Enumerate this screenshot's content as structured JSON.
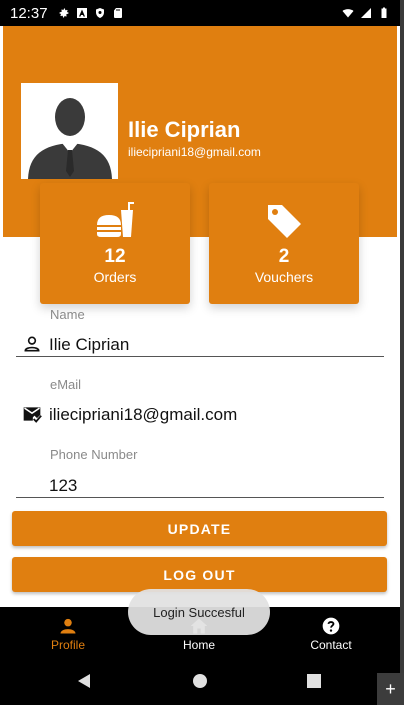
{
  "status_bar": {
    "time": "12:37"
  },
  "profile": {
    "name": "Ilie Ciprian",
    "email": "iliecipriani18@gmail.com"
  },
  "stats": {
    "orders": {
      "count": "12",
      "label": "Orders",
      "icon": "burger-drink-icon"
    },
    "vouchers": {
      "count": "2",
      "label": "Vouchers",
      "icon": "tag-icon"
    }
  },
  "form": {
    "name": {
      "label": "Name",
      "value": "Ilie Ciprian",
      "icon": "person-icon"
    },
    "email": {
      "label": "eMail",
      "value": "iliecipriani18@gmail.com",
      "icon": "mail-check-icon"
    },
    "phone": {
      "label": "Phone Number",
      "value": "123"
    }
  },
  "buttons": {
    "update": "UPDATE",
    "logout": "LOG OUT"
  },
  "toast": {
    "message": "Login Succesful"
  },
  "bottom_nav": {
    "items": [
      {
        "label": "Profile",
        "icon": "person-icon",
        "active": true
      },
      {
        "label": "Home",
        "icon": "home-icon",
        "active": false
      },
      {
        "label": "Contact",
        "icon": "help-circle-icon",
        "active": false
      }
    ]
  },
  "colors": {
    "accent": "#e07f10",
    "nav_bg": "#000000",
    "text": "#111111",
    "label": "#8a8a8a"
  }
}
